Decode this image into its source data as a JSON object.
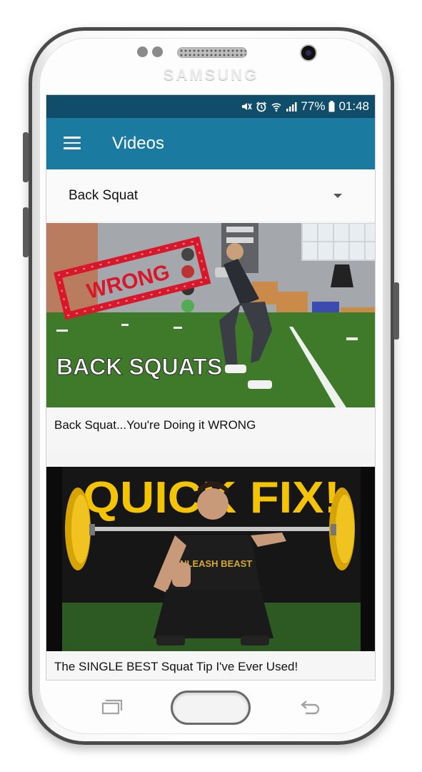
{
  "device": {
    "brand": "SAMSUNG"
  },
  "status_bar": {
    "battery": "77%",
    "time": "01:48"
  },
  "app_bar": {
    "title": "Videos"
  },
  "spinner": {
    "selected": "Back Squat"
  },
  "videos": [
    {
      "title": "Back Squat...You're Doing it WRONG",
      "overlay_text": "BACK SQUATS",
      "stamp_text": "WRONG"
    },
    {
      "title": "The SINGLE BEST Squat Tip I've Ever Used!",
      "overlay_text": "QUICK FIX!",
      "shirt_text": "UNLEASH BEAST"
    }
  ],
  "colors": {
    "status_bar": "#0f4d6b",
    "app_bar": "#1a7aa0",
    "stamp": "#d8182a",
    "quick_fix": "#f5c400"
  }
}
